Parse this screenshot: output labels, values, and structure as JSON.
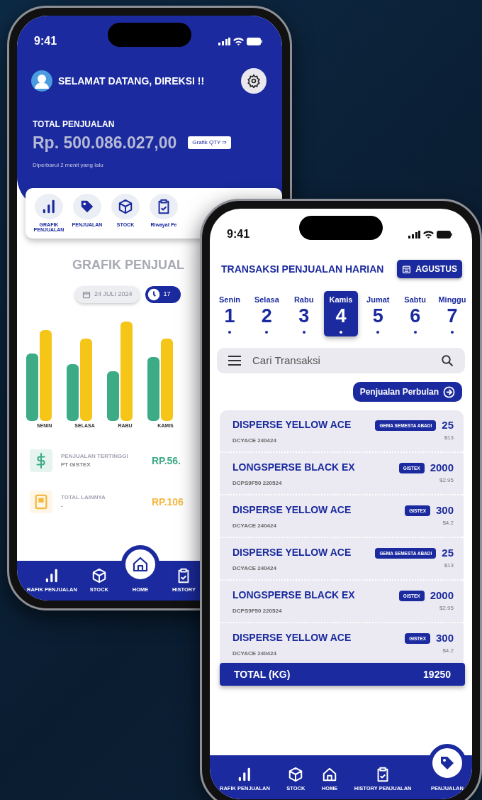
{
  "home_screen": {
    "status_time": "9:41",
    "greeting": "SELAMAT DATANG, DIREKSI !!",
    "total_label": "TOTAL PENJUALAN",
    "total_amount": "Rp. 500.086.027,00",
    "qty_button": "Grafik QTY ⇒",
    "updated": "Diperbarui 2 menit yang lalu",
    "menu": [
      {
        "label": "GRAFIK PENJUALAN",
        "kind": "chart"
      },
      {
        "label": "PENJUALAN",
        "kind": "tag"
      },
      {
        "label": "STOCK",
        "kind": "box"
      },
      {
        "label": "Riwayat Pe",
        "kind": "clipboard"
      }
    ],
    "chart_title": "GRAFIK PENJUAL",
    "date": "24 JULI 2024",
    "time": "17",
    "chart_labels": [
      "SENIN",
      "SELASA",
      "RABU",
      "KAMIS"
    ],
    "stats": [
      {
        "label": "PENJUALAN TERTINGGI",
        "sub": "PT GISTEX",
        "value": "RP.56.",
        "color": "#3dab85",
        "kind": "dollar"
      },
      {
        "label": "TOTAL LAINNYA",
        "sub": "-",
        "value": "RP.106",
        "color": "#f5b942",
        "kind": "book"
      }
    ],
    "nav": [
      {
        "label": "RAFIK PENJUALAN",
        "kind": "chart",
        "selected": false
      },
      {
        "label": "STOCK",
        "kind": "box",
        "selected": false
      },
      {
        "label": "HOME",
        "kind": "home",
        "selected": true
      },
      {
        "label": "HISTORY",
        "kind": "clipboard",
        "selected": false
      }
    ]
  },
  "sales_screen": {
    "status_time": "9:41",
    "title": "TRANSAKSI PENJUALAN HARIAN",
    "month_button": "AGUSTUS",
    "days": [
      {
        "name": "Senin",
        "date": "1",
        "selected": false
      },
      {
        "name": "Selasa",
        "date": "2",
        "selected": false
      },
      {
        "name": "Rabu",
        "date": "3",
        "selected": false
      },
      {
        "name": "Kamis",
        "date": "4",
        "selected": true
      },
      {
        "name": "Jumat",
        "date": "5",
        "selected": false
      },
      {
        "name": "Sabtu",
        "date": "6",
        "selected": false
      },
      {
        "name": "Minggu",
        "date": "7",
        "selected": false
      }
    ],
    "search": {
      "placeholder": "Cari Transaksi"
    },
    "monthly_button": "Penjualan Perbulan",
    "transactions": [
      {
        "product": "DISPERSE YELLOW ACE",
        "code": "DCYACE 240424",
        "customer": "GEMA SEMESTA ABADI",
        "qty": "25",
        "price": "$13"
      },
      {
        "product": "LONGSPERSE BLACK EX",
        "code": "DCPS9F50 220524",
        "customer": "GISTEX",
        "qty": "2000",
        "price": "$2.95"
      },
      {
        "product": "DISPERSE YELLOW ACE",
        "code": "DCYACE 240424",
        "customer": "GISTEX",
        "qty": "300",
        "price": "$4.2"
      },
      {
        "product": "DISPERSE YELLOW ACE",
        "code": "DCYACE 240424",
        "customer": "GEMA SEMESTA ABADI",
        "qty": "25",
        "price": "$13"
      },
      {
        "product": "LONGSPERSE BLACK EX",
        "code": "DCPS9F50 220524",
        "customer": "GISTEX",
        "qty": "2000",
        "price": "$2.95"
      },
      {
        "product": "DISPERSE YELLOW ACE",
        "code": "DCYACE 240424",
        "customer": "GISTEX",
        "qty": "300",
        "price": "$4.2"
      }
    ],
    "total": {
      "label": "TOTAL (KG)",
      "value": "19250"
    },
    "nav": [
      {
        "label": "RAFIK PENJUALAN",
        "kind": "chart",
        "selected": false
      },
      {
        "label": "STOCK",
        "kind": "box",
        "selected": false
      },
      {
        "label": "HOME",
        "kind": "home",
        "selected": false
      },
      {
        "label": "HISTORY PENJUALAN",
        "kind": "clipboard",
        "selected": false
      },
      {
        "label": "PENJUALAN",
        "kind": "tag",
        "selected": true
      }
    ]
  }
}
